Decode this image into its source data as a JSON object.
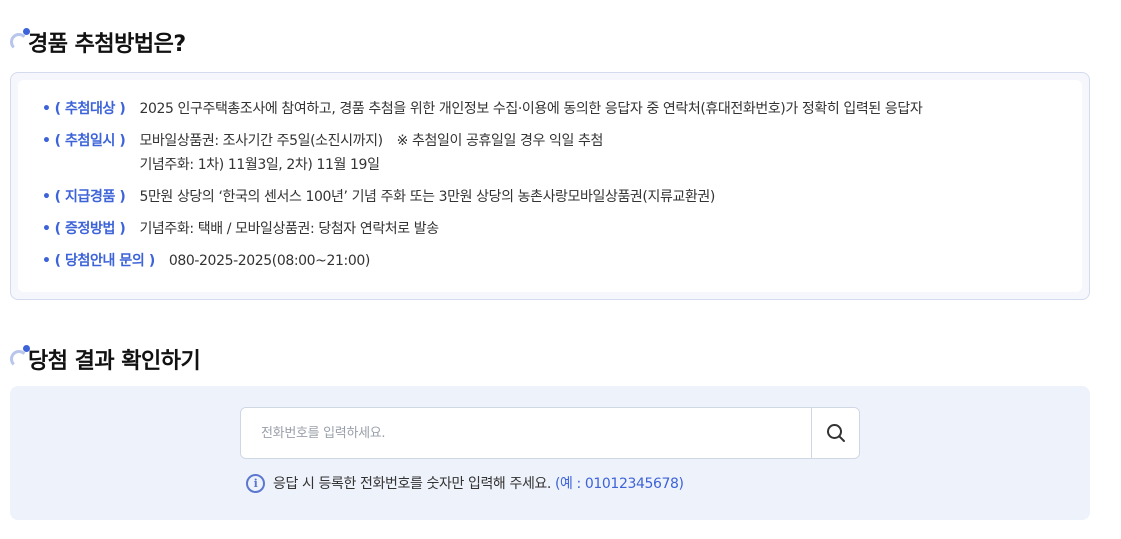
{
  "prize_section": {
    "title": "경품 추첨방법은?",
    "rows": [
      {
        "label": "( 추첨대상 )",
        "value": "2025 인구주택총조사에 참여하고, 경품 추첨을 위한 개인정보 수집·이용에 동의한 응답자 중 연락처(휴대전화번호)가 정확히 입력된 응답자"
      },
      {
        "label": "( 추첨일시 )",
        "value": "모바일상품권: 조사기간 주5일(소진시까지)",
        "note": "※ 추첨일이 공휴일일 경우 익일 추첨",
        "value_line2": "기념주화: 1차) 11월3일, 2차) 11월 19일"
      },
      {
        "label": "( 지급경품 )",
        "value": "5만원 상당의 ‘한국의 센서스 100년’ 기념 주화 또는 3만원 상당의 농촌사랑모바일상품권(지류교환권)"
      },
      {
        "label": "( 증정방법 )",
        "value": "기념주화: 택배 / 모바일상품권: 당첨자 연락처로 발송"
      },
      {
        "label": "( 당첨안내 문의 )",
        "value": "080-2025-2025(08:00~21:00)"
      }
    ],
    "bullet": "•"
  },
  "result_section": {
    "title": "당첨 결과 확인하기",
    "search": {
      "placeholder": "전화번호를 입력하세요.",
      "value": "",
      "button_icon": "search-icon"
    },
    "hint": {
      "icon": "info-icon",
      "icon_glyph": "i",
      "text": "응답 시 등록한 전화번호를 숫자만 입력해 주세요.",
      "example": "(예 : 01012345678)"
    }
  },
  "colors": {
    "accent": "#3d63d8",
    "box_bg": "#f5f7fc",
    "search_bg": "#eef2fb",
    "border": "#d4dbef"
  }
}
